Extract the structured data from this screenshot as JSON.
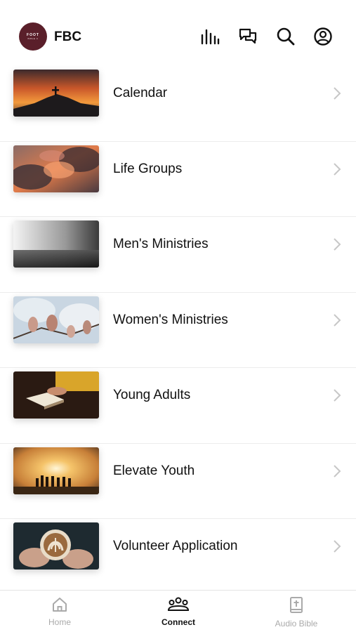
{
  "header": {
    "logo_text": "FOOT",
    "logo_sub": "BIBLE C",
    "app_name": "FBC",
    "icons": [
      "audio-bars-icon",
      "chat-icon",
      "search-icon",
      "profile-icon"
    ]
  },
  "menu": {
    "items": [
      {
        "label": "Calendar",
        "image": "sunset-cross-image"
      },
      {
        "label": "Life Groups",
        "image": "clouds-image"
      },
      {
        "label": "Men's Ministries",
        "image": "misty-sea-image"
      },
      {
        "label": "Women's Ministries",
        "image": "magnolia-image"
      },
      {
        "label": "Young Adults",
        "image": "open-bible-image"
      },
      {
        "label": "Elevate Youth",
        "image": "silhouettes-sunset-image"
      },
      {
        "label": "Volunteer Application",
        "image": "latte-art-image"
      }
    ]
  },
  "tabbar": {
    "tabs": [
      {
        "label": "Home",
        "icon": "home-icon",
        "active": false
      },
      {
        "label": "Connect",
        "icon": "people-icon",
        "active": true
      },
      {
        "label": "Audio Bible",
        "icon": "bible-icon",
        "active": false
      }
    ]
  },
  "colors": {
    "logo_bg": "#5a1f2a",
    "active_tab": "#111111",
    "inactive_tab": "#aaaaaa",
    "chevron": "#c7c7c7"
  }
}
